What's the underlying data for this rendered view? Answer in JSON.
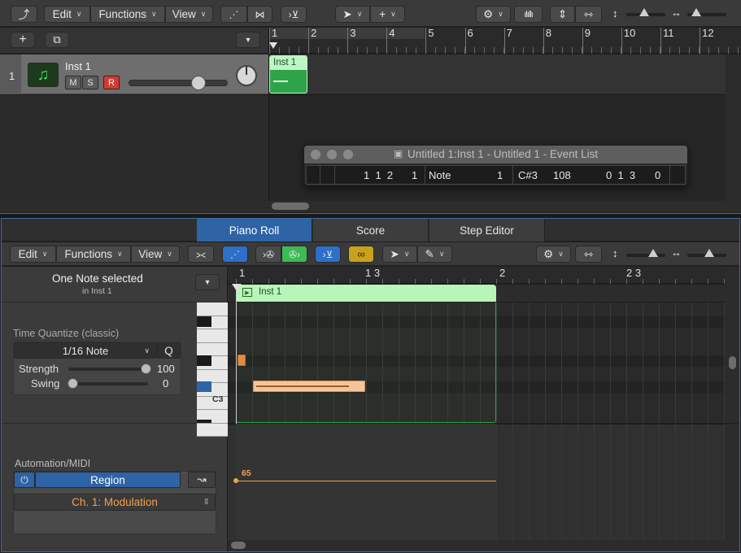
{
  "top_toolbar": {
    "edit": "Edit",
    "functions": "Functions",
    "view": "View"
  },
  "track": {
    "number": "1",
    "name": "Inst 1",
    "mute": "M",
    "solo": "S",
    "record": "R",
    "volume_level": 0.72
  },
  "ruler": {
    "bars": [
      "1",
      "2",
      "3",
      "4",
      "5",
      "6",
      "7",
      "8",
      "9",
      "10",
      "11",
      "12"
    ]
  },
  "region": {
    "name": "Inst 1"
  },
  "event_list": {
    "title": "Untitled 1:Inst 1 - Untitled 1 - Event List",
    "row": {
      "position": "1  1  2",
      "sub": "1",
      "status": "Note",
      "channel": "1",
      "num": "C#3",
      "val": "108",
      "length": "0  1  3",
      "info": "0"
    }
  },
  "tabs": {
    "piano_roll": "Piano Roll",
    "score": "Score",
    "step_editor": "Step Editor"
  },
  "editor_toolbar": {
    "edit": "Edit",
    "functions": "Functions",
    "view": "View"
  },
  "inspector": {
    "selection_title": "One Note selected",
    "selection_sub": "in Inst 1",
    "time_quantize_label": "Time Quantize (classic)",
    "quantize_value": "1/16 Note",
    "q_button": "Q",
    "strength_label": "Strength",
    "strength_value": "100",
    "swing_label": "Swing",
    "swing_value": "0",
    "automation_label": "Automation/MIDI",
    "region_button": "Region",
    "controller": "Ch. 1: Modulation"
  },
  "editor_ruler": {
    "m1": "1",
    "m13": "1 3",
    "m2": "2",
    "m23": "2 3"
  },
  "editor_region": {
    "name": "Inst 1"
  },
  "keyboard": {
    "c3": "C3"
  },
  "automation": {
    "value": "65"
  },
  "colors": {
    "region_green": "#b8f5b8",
    "accent_blue": "#2a6fc8",
    "note_orange": "#f4c59a",
    "automation_orange": "#f0a050",
    "record_red": "#d63a2e"
  }
}
